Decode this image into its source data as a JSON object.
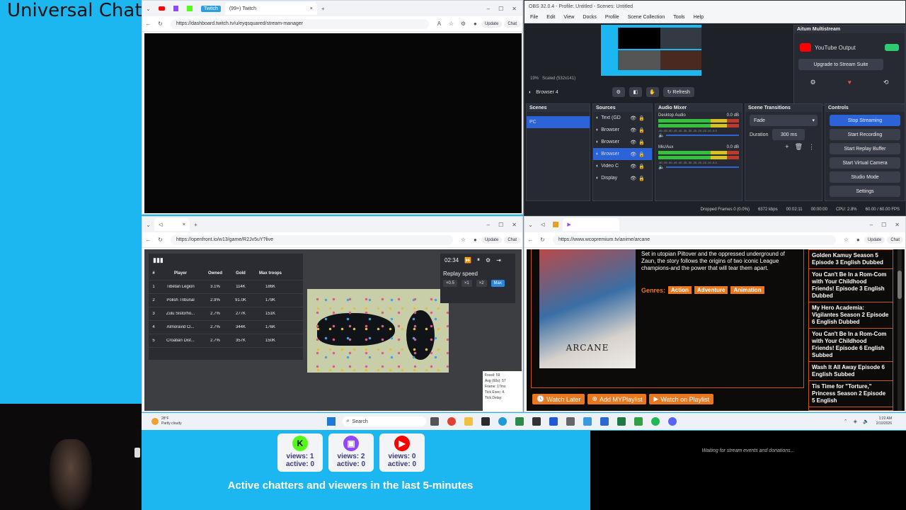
{
  "overlay": {
    "title": "Universal Chat",
    "events_text": "Waiting for stream events and donations...",
    "active_title": "Active chatters and viewers in the last 5-minutes",
    "platforms": [
      {
        "name": "Kick",
        "icon": "kick-icon",
        "color": "#53fc18",
        "views": "views: 1",
        "active": "active: 0"
      },
      {
        "name": "Twitch",
        "icon": "twitch-icon",
        "color": "#9146ff",
        "views": "views: 2",
        "active": "active: 0"
      },
      {
        "name": "YouTube",
        "icon": "youtube-icon",
        "color": "#ff0000",
        "views": "views: 0",
        "active": "active: 0"
      }
    ]
  },
  "twitch_browser": {
    "tab_badge": "Twitch",
    "tab_title": "(99+) Twitch",
    "url": "https://dashboard.twitch.tv/u/eyqsquared/stream-manager",
    "update_label": "Update",
    "chat_label": "Chat"
  },
  "obs": {
    "title": "OBS 32.0.4 - Profile: Untitled - Scenes: Untitled",
    "menu": [
      "File",
      "Edit",
      "View",
      "Docks",
      "Profile",
      "Scene Collection",
      "Tools",
      "Help"
    ],
    "multistream": {
      "title": "Aitum Multistream",
      "youtube_label": "YouTube Output",
      "upgrade_label": "Upgrade to Stream Suite"
    },
    "zoom": "19%",
    "scaled": "Scaled (532x141)",
    "source_name": "Browser 4",
    "refresh_label": "Refresh",
    "scenes_header": "Scenes",
    "scenes": [
      "PC"
    ],
    "sources_header": "Sources",
    "sources": [
      "Text (GD",
      "Browser",
      "Browser",
      "Browser",
      "Video C",
      "Display"
    ],
    "mixer_header": "Audio Mixer",
    "mixer": [
      {
        "name": "Desktop Audio",
        "db": "0.0 dB"
      },
      {
        "name": "Mic/Aux",
        "db": "0.0 dB"
      }
    ],
    "meter_ticks": "-60 -55 -50 -45 -40 -35 -30 -25 -20 -15 -10 -5 0",
    "transitions_header": "Scene Transitions",
    "transition": "Fade",
    "duration_label": "Duration",
    "duration": "300 ms",
    "controls_header": "Controls",
    "controls": [
      "Stop Streaming",
      "Start Recording",
      "Start Replay Buffer",
      "Start Virtual Camera",
      "Studio Mode",
      "Settings"
    ],
    "status": {
      "dropped": "Dropped Frames 0 (0.0%)",
      "kbps": "6372 kbps",
      "live": "00:02:11",
      "rec": "00:00:00",
      "cpu": "CPU: 2.8%",
      "fps": "60.00 / 60.00 FPS"
    }
  },
  "openfront_browser": {
    "url": "https://openfront.io/w13/game/R2Jv5uY?live",
    "headers": [
      "#",
      "Player",
      "Owned",
      "Gold",
      "Max troops"
    ],
    "rows": [
      [
        "1",
        "Tibetan Legion",
        "3.1%",
        "114K",
        "186K"
      ],
      [
        "2",
        "Polish Tribunal",
        "2.9%",
        "91.0K",
        "179K"
      ],
      [
        "3",
        "Zulu Sistorho...",
        "2.7%",
        "277K",
        "151K"
      ],
      [
        "4",
        "Almoravid Cl...",
        "2.7%",
        "344K",
        "176K"
      ],
      [
        "5",
        "Croatian Dist...",
        "2.7%",
        "357K",
        "150K"
      ]
    ],
    "time": "02:34",
    "replay_speed": "Replay speed",
    "speeds": [
      "×0.5",
      "×1",
      "×2",
      "Max"
    ],
    "perf": [
      "Fossil: 59",
      "Avg (60s): 57",
      "Frame: 17ms",
      "Tick Exec: 4.",
      "Tick Delay:"
    ]
  },
  "anime_browser": {
    "url": "https://www.wcopremium.tv/anime/arcane",
    "update_label": "Update",
    "chat_label": "Chat",
    "poster_title": "ARCANE",
    "description": "Set in utopian Piltover and the oppressed underground of Zaun, the story follows the origins of two iconic League champions-and the power that will tear them apart.",
    "genres_label": "Genres:",
    "genres": [
      "Action",
      "Adventure",
      "Animation"
    ],
    "sidebar": [
      "Golden Kamuy Season 5 Episode 3 English Dubbed",
      "You Can't Be In a Rom-Com with Your Childhood Friends! Episode 3 English Dubbed",
      "My Hero Academia: Vigilantes Season 2 Episode 6 English Dubbed",
      "You Can't Be In a Rom-Com with Your Childhood Friends! Episode 6 English Subbed",
      "Wash It All Away Episode 6 English Subbed",
      "Tis Time for \"Torture,\" Princess Season 2 Episode 5 English"
    ],
    "buttons": [
      "Watch Later",
      "Add MYPlaylist",
      "Watch on Playlist"
    ]
  },
  "taskbar": {
    "weather_temp": "28°F",
    "weather_desc": "Partly cloudy",
    "search_placeholder": "Search",
    "time": "1:22 AM",
    "date": "2/10/2026"
  }
}
